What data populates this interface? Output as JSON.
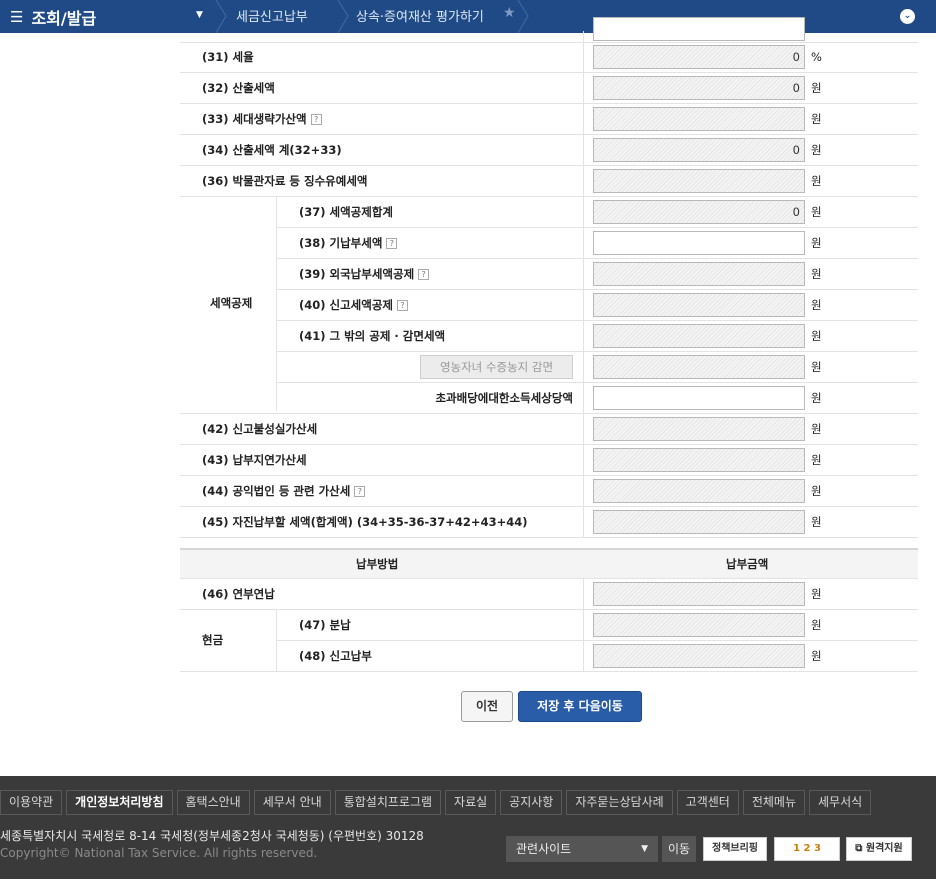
{
  "topbar": {
    "menu_icon": "hamburger-icon",
    "menu_title": "조회/발급",
    "crumb1": "세금신고납부",
    "crumb2": "상속·증여재산 평가하기",
    "collapse_icon": "chevron-down-icon"
  },
  "rows": {
    "r31": {
      "label": "(31) 세율",
      "value": "0",
      "unit": "%"
    },
    "r32": {
      "label": "(32) 산출세액",
      "value": "0",
      "unit": "원"
    },
    "r33": {
      "label": "(33) 세대생략가산액",
      "value": "",
      "unit": "원"
    },
    "r34": {
      "label": "(34) 산출세액 계(32+33)",
      "value": "0",
      "unit": "원"
    },
    "r36": {
      "label": "(36) 박물관자료 등 징수유예세액",
      "value": "",
      "unit": "원"
    },
    "r37": {
      "label": "(37) 세액공제합계",
      "value": "0",
      "unit": "원"
    },
    "r38": {
      "label": "(38) 기납부세액",
      "value": "",
      "unit": "원"
    },
    "r39": {
      "label": "(39) 외국납부세액공제",
      "value": "",
      "unit": "원"
    },
    "r40": {
      "label": "(40) 신고세액공제",
      "value": "",
      "unit": "원"
    },
    "r41": {
      "label": "(41) 그 밖의 공제 · 감면세액",
      "value": "",
      "unit": "원"
    },
    "r41a": {
      "button": "영농자녀 수증농지 감면",
      "value": "",
      "unit": "원"
    },
    "r41b": {
      "label": "초과배당에대한소득세상당액",
      "value": "",
      "unit": "원"
    },
    "r42": {
      "label": "(42) 신고불성실가산세",
      "value": "",
      "unit": "원"
    },
    "r43": {
      "label": "(43) 납부지연가산세",
      "value": "",
      "unit": "원"
    },
    "r44": {
      "label": "(44) 공익법인 등 관련 가산세",
      "value": "",
      "unit": "원"
    },
    "r45": {
      "label": "(45) 자진납부할 세액(합계액) (34+35-36-37+42+43+44)",
      "value": "",
      "unit": "원"
    }
  },
  "group_label": "세액공제",
  "help_mark": "?",
  "payment": {
    "head_method": "납부방법",
    "head_amount": "납부금액",
    "r46": {
      "label": "(46) 연부연납",
      "value": "",
      "unit": "원"
    },
    "cash_label": "현금",
    "r47": {
      "label": "(47) 분납",
      "value": "",
      "unit": "원"
    },
    "r48": {
      "label": "(48) 신고납부",
      "value": "",
      "unit": "원"
    }
  },
  "buttons": {
    "prev": "이전",
    "next": "저장 후 다음이동"
  },
  "footer": {
    "links": [
      "이용약관",
      "개인정보처리방침",
      "홈택스안내",
      "세무서 안내",
      "통합설치프로그램",
      "자료실",
      "공지사항",
      "자주묻는상담사례",
      "고객센터",
      "전체메뉴",
      "세무서식"
    ],
    "address": "세종특별자치시 국세청로 8-14 국세청(정부세종2청사 국세청동) (우편번호) 30128",
    "copyright": "Copyright© National Tax Service. All rights reserved.",
    "related_select": "관련사이트",
    "go": "이동",
    "banner1": "정책브리핑",
    "banner2": "1 2 3",
    "banner3": "원격지원"
  }
}
